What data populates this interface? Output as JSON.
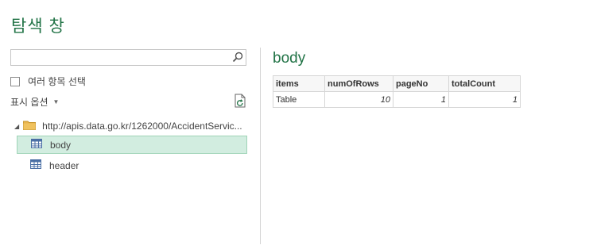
{
  "window": {
    "title": "탐색 창"
  },
  "search": {
    "value": "",
    "placeholder": ""
  },
  "select_multiple": {
    "label": "여러 항목 선택",
    "checked": false
  },
  "display_options": {
    "label": "표시 옵션"
  },
  "tree": {
    "root": {
      "label": "http://apis.data.go.kr/1262000/AccidentServic..."
    },
    "items": [
      {
        "label": "body",
        "selected": true
      },
      {
        "label": "header",
        "selected": false
      }
    ]
  },
  "preview": {
    "title": "body",
    "columns": [
      "items",
      "numOfRows",
      "pageNo",
      "totalCount"
    ],
    "rows": [
      [
        "Table",
        "10",
        "1",
        "1"
      ]
    ]
  },
  "colors": {
    "accent": "#217346",
    "selected_bg": "#d2ede0",
    "selected_border": "#9fd4b7"
  },
  "icons": [
    "search-icon",
    "refresh-icon",
    "folder-icon",
    "table-icon",
    "expand-icon",
    "chevron-down-icon"
  ]
}
